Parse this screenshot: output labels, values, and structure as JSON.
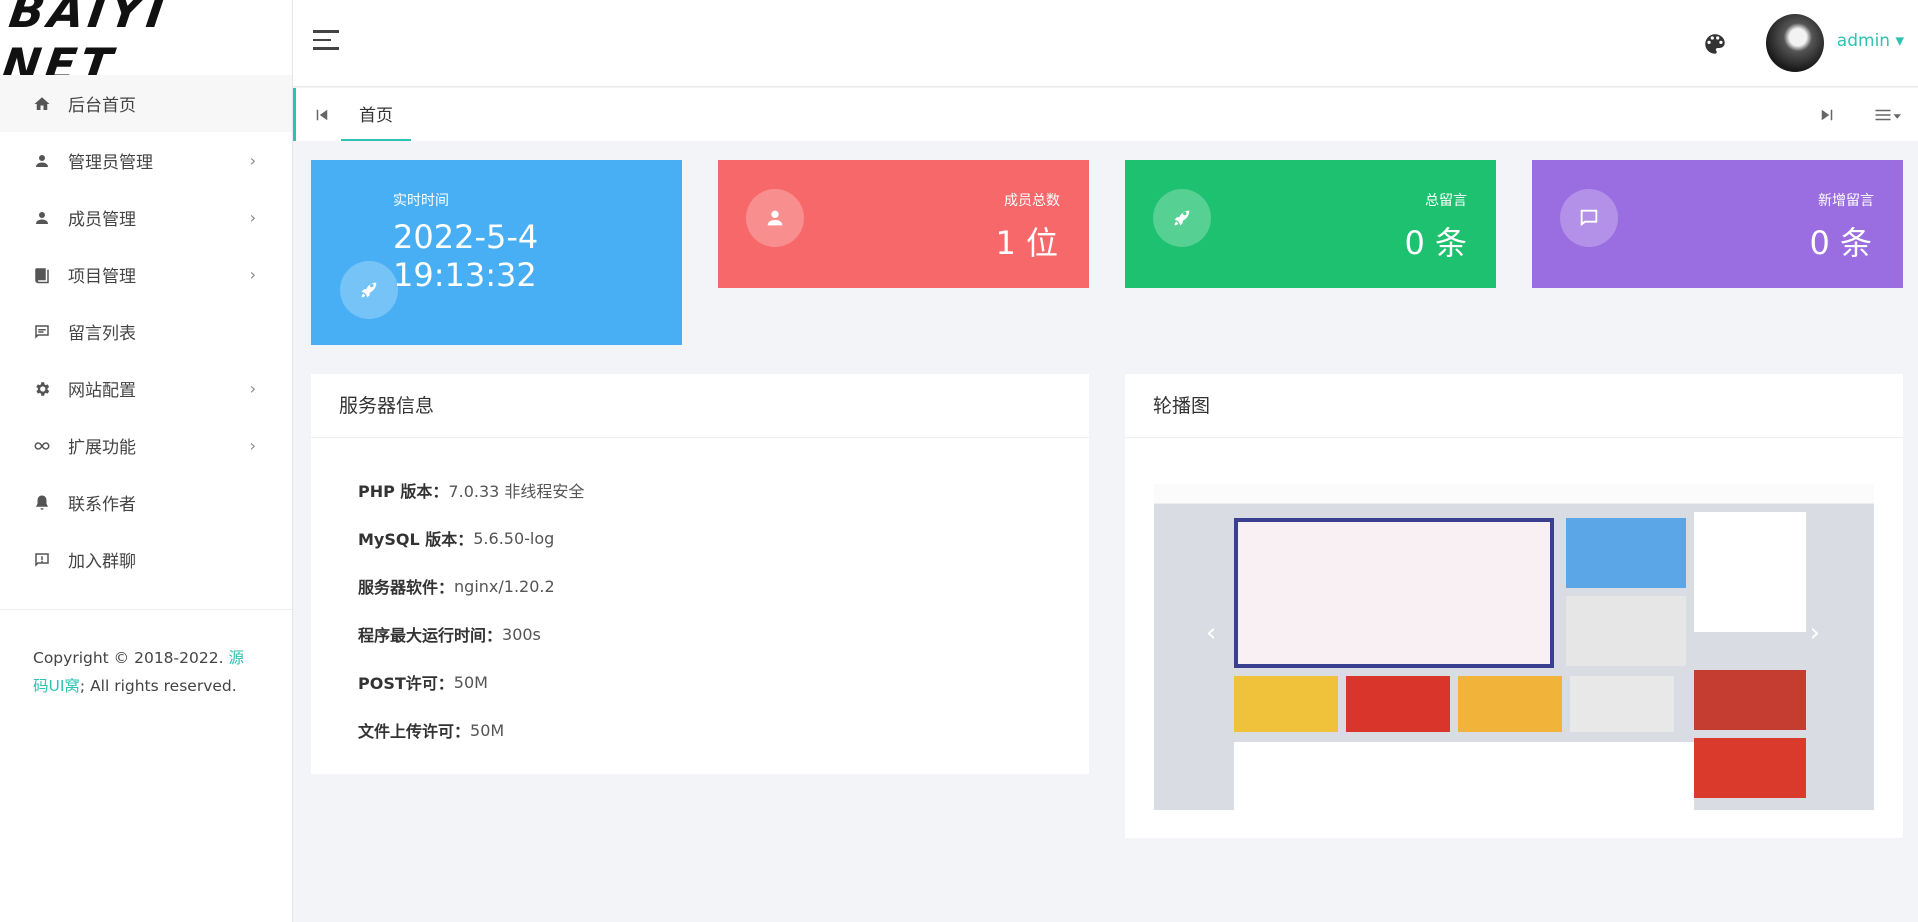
{
  "brand": {
    "logo_text": "BAIYI NET"
  },
  "sidebar": {
    "items": [
      {
        "label": "后台首页",
        "icon": "home-icon",
        "has_children": false,
        "active": true
      },
      {
        "label": "管理员管理",
        "icon": "user-icon",
        "has_children": true
      },
      {
        "label": "成员管理",
        "icon": "user-icon",
        "has_children": true
      },
      {
        "label": "项目管理",
        "icon": "book-icon",
        "has_children": true
      },
      {
        "label": "留言列表",
        "icon": "message-icon",
        "has_children": false
      },
      {
        "label": "网站配置",
        "icon": "gear-icon",
        "has_children": true
      },
      {
        "label": "扩展功能",
        "icon": "infinity-icon",
        "has_children": true
      },
      {
        "label": "联系作者",
        "icon": "bell-icon",
        "has_children": false
      },
      {
        "label": "加入群聊",
        "icon": "chat-alert-icon",
        "has_children": false
      }
    ],
    "chevron": "›",
    "copyright_prefix": "Copyright © 2018-2022. ",
    "copyright_link": "源码UI窝",
    "copyright_suffix": "; All rights reserved."
  },
  "header": {
    "user_name": "admin ▾"
  },
  "tabs": {
    "items": [
      {
        "label": "首页"
      }
    ]
  },
  "stats": {
    "realtime": {
      "label": "实时时间",
      "value": "2022-5-4 19:13:32",
      "color": "#48aff5"
    },
    "members": {
      "label": "成员总数",
      "value": "1 位",
      "color": "#f7686a"
    },
    "messages": {
      "label": "总留言",
      "value": "0 条",
      "color": "#1ec16f"
    },
    "new_messages": {
      "label": "新增留言",
      "value": "0 条",
      "color": "#9a6de0"
    }
  },
  "server_panel": {
    "title": "服务器信息",
    "rows": [
      {
        "key": "PHP 版本：",
        "value": "7.0.33 非线程安全"
      },
      {
        "key": "MySQL 版本：",
        "value": "5.6.50-log"
      },
      {
        "key": "服务器软件：",
        "value": "nginx/1.20.2"
      },
      {
        "key": "程序最大运行时间：",
        "value": "300s"
      },
      {
        "key": "POST许可：",
        "value": "50M"
      },
      {
        "key": "文件上传许可：",
        "value": "50M"
      }
    ]
  },
  "carousel_panel": {
    "title": "轮播图",
    "prev": "‹",
    "next": "›"
  },
  "colors": {
    "accent": "#2ec2b3"
  }
}
